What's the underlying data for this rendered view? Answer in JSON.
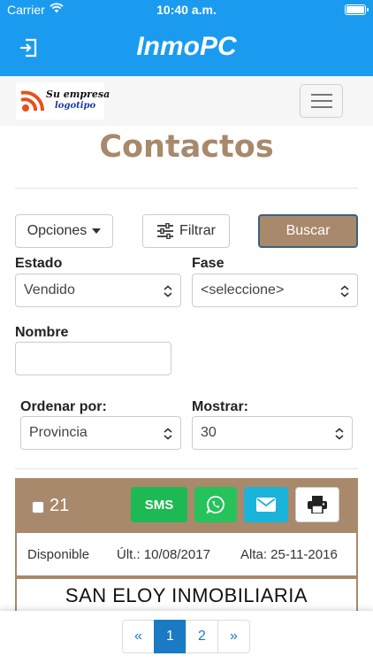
{
  "status": {
    "carrier": "Carrier",
    "time": "10:40 a.m."
  },
  "app": {
    "title": "InmoPC"
  },
  "brand": {
    "line1": "Su empresa",
    "line2": "logotipo"
  },
  "page": {
    "title": "Contactos"
  },
  "toolbar": {
    "options_label": "Opciones",
    "filter_label": "Filtrar",
    "search_label": "Buscar"
  },
  "filters": {
    "estado": {
      "label": "Estado",
      "value": "Vendido"
    },
    "fase": {
      "label": "Fase",
      "value": "<seleccione>"
    },
    "nombre": {
      "label": "Nombre",
      "value": ""
    },
    "ordenar": {
      "label": "Ordenar por:",
      "value": "Provincia"
    },
    "mostrar": {
      "label": "Mostrar:",
      "value": "30"
    }
  },
  "contact": {
    "count": "21",
    "sms_label": "SMS",
    "availability": "Disponible",
    "last_update": "Últ.: 10/08/2017",
    "created": "Alta: 25-11-2016",
    "name": "SAN ELOY INMOBILIARIA"
  },
  "pagination": {
    "prev": "«",
    "pages": [
      "1",
      "2"
    ],
    "current_page": "1",
    "next": "»"
  },
  "colors": {
    "primary": "#1a9bf0",
    "accent": "#a8896b",
    "sms": "#1db954",
    "whatsapp": "#25c35a",
    "email": "#1ab3d9",
    "page_active": "#1a7bc4"
  }
}
